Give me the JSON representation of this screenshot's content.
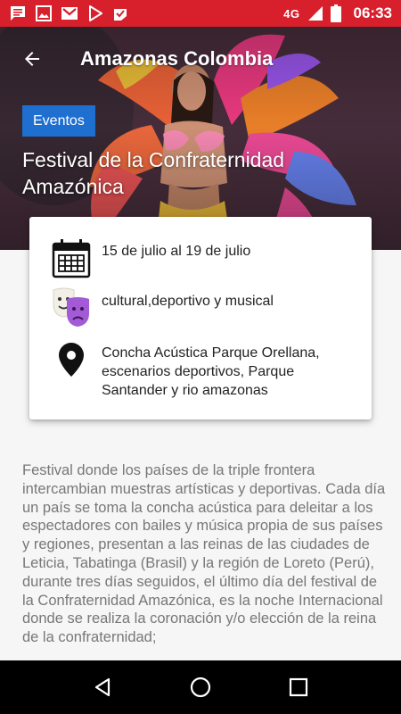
{
  "status_bar": {
    "network": "4G",
    "time": "06:33",
    "icons": [
      "message-icon",
      "image-icon",
      "gmail-icon",
      "play-store-icon",
      "check-icon"
    ],
    "background_color": "#d8202d"
  },
  "app_bar": {
    "title": "Amazonas Colombia"
  },
  "event": {
    "category": "Eventos",
    "title": "Festival de la Confraternidad Amazónica",
    "badge_color": "#1f6fd1"
  },
  "info_card": {
    "date": "15 de julio al 19 de julio",
    "type": "cultural,deportivo y musical",
    "location": "Concha Acústica Parque Orellana, escenarios deportivos, Parque Santander y  rio amazonas"
  },
  "description": "Festival donde los países de la triple frontera intercambian muestras artísticas y deportivas. Cada día un país se toma la concha acústica para deleitar a los espectadores con bailes y música propia de sus países y regiones, presentan a las reinas de las ciudades de Leticia, Tabatinga (Brasil) y la región de Loreto (Perú), durante tres días seguidos, el último día del festival de la Confraternidad Amazónica, es la noche Internacional donde se realiza la coronación y/o elección de la reina de la confraternidad;",
  "nav_bar": {
    "buttons": [
      "back-nav-icon",
      "home-nav-icon",
      "recents-nav-icon"
    ]
  }
}
